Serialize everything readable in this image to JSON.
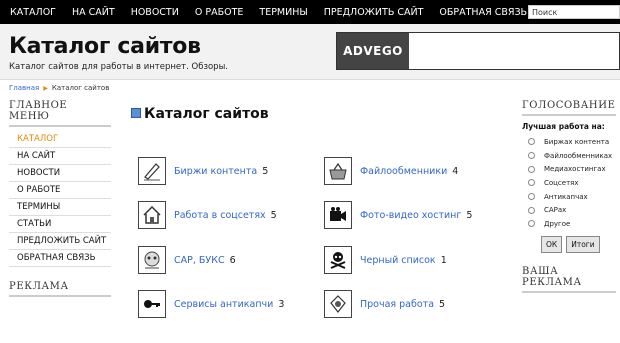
{
  "topnav": {
    "items": [
      "КАТАЛОГ",
      "НА САЙТ",
      "НОВОСТИ",
      "О РАБОТЕ",
      "ТЕРМИНЫ",
      "ПРЕДЛОЖИТЬ САЙТ",
      "ОБРАТНАЯ СВЯЗЬ"
    ]
  },
  "search": {
    "value": "Поиск"
  },
  "header": {
    "title": "Каталог сайтов",
    "subtitle": "Каталог сайтов для работы в интернет. Обзоры.",
    "ad_logo": "ADVEGO"
  },
  "breadcrumb": {
    "home": "Главная",
    "current": "Каталог сайтов"
  },
  "left_sidebar": {
    "menu_title": "ГЛАВНОЕ МЕНЮ",
    "menu": [
      "КАТАЛОГ",
      "НА САЙТ",
      "НОВОСТИ",
      "О РАБОТЕ",
      "ТЕРМИНЫ",
      "СТАТЬИ",
      "ПРЕДЛОЖИТЬ САЙТ",
      "ОБРАТНАЯ СВЯЗЬ"
    ],
    "ads_title": "РЕКЛАМА"
  },
  "main": {
    "title": "Каталог сайтов",
    "categories": [
      {
        "name": "Биржи контента",
        "count": "5",
        "icon": "content-exchange-icon"
      },
      {
        "name": "Файлообменники",
        "count": "4",
        "icon": "file-sharing-icon"
      },
      {
        "name": "Работа в соцсетях",
        "count": "5",
        "icon": "home-icon"
      },
      {
        "name": "Фото-видео хостинг",
        "count": "5",
        "icon": "camera-icon"
      },
      {
        "name": "САР, БУКС",
        "count": "6",
        "icon": "skull-ball-icon"
      },
      {
        "name": "Черный список",
        "count": "1",
        "icon": "skull-crossbones-icon"
      },
      {
        "name": "Сервисы антикапчи",
        "count": "3",
        "icon": "key-icon"
      },
      {
        "name": "Прочая работа",
        "count": "5",
        "icon": "misc-work-icon"
      }
    ]
  },
  "right_sidebar": {
    "vote_title": "ГОЛОСОВАНИЕ",
    "question": "Лучшая работа на:",
    "options": [
      "Биржах контента",
      "Файлообменниках",
      "Медиахостингах",
      "Соцсетях",
      "Антикапчах",
      "САРах",
      "Другое"
    ],
    "ok_label": "ОК",
    "results_label": "Итоги",
    "your_ads_title": "ВАША РЕКЛАМА"
  },
  "colors": {
    "topbar": "#000000",
    "link": "#3366cc",
    "active": "#e08a00"
  }
}
